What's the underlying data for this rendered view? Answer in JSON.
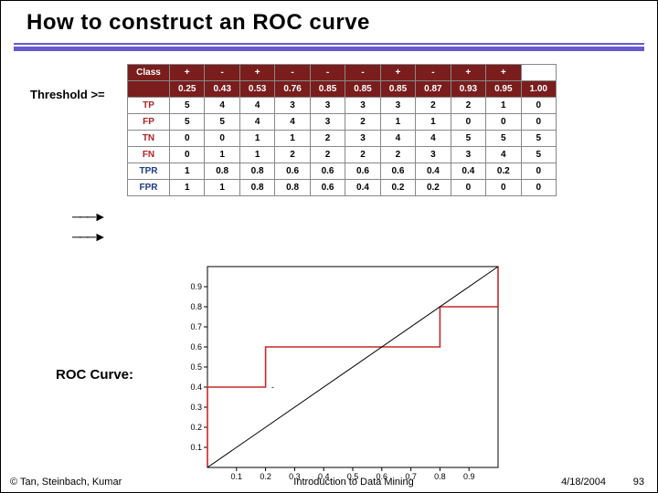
{
  "title": "How to construct an ROC curve",
  "labels": {
    "threshold": "Threshold >=",
    "roc_curve": "ROC Curve:"
  },
  "table": {
    "row_headers": [
      "Class",
      "",
      "TP",
      "FP",
      "TN",
      "FN",
      "TPR",
      "FPR"
    ],
    "class_row": [
      "+",
      "-",
      "+",
      "-",
      "-",
      "-",
      "+",
      "-",
      "+",
      "+",
      ""
    ],
    "threshold_row": [
      "0.25",
      "0.43",
      "0.53",
      "0.76",
      "0.85",
      "0.85",
      "0.85",
      "0.87",
      "0.93",
      "0.95",
      "1.00"
    ],
    "tp": [
      "5",
      "4",
      "4",
      "3",
      "3",
      "3",
      "3",
      "2",
      "2",
      "1",
      "0"
    ],
    "fp": [
      "5",
      "5",
      "4",
      "4",
      "3",
      "2",
      "1",
      "1",
      "0",
      "0",
      "0"
    ],
    "tn": [
      "0",
      "0",
      "1",
      "1",
      "2",
      "3",
      "4",
      "4",
      "5",
      "5",
      "5"
    ],
    "fn": [
      "0",
      "1",
      "1",
      "2",
      "2",
      "2",
      "2",
      "3",
      "3",
      "4",
      "5"
    ],
    "tpr": [
      "1",
      "0.8",
      "0.8",
      "0.6",
      "0.6",
      "0.6",
      "0.6",
      "0.4",
      "0.4",
      "0.2",
      "0"
    ],
    "fpr": [
      "1",
      "1",
      "0.8",
      "0.8",
      "0.6",
      "0.4",
      "0.2",
      "0.2",
      "0",
      "0",
      "0"
    ]
  },
  "chart_data": {
    "type": "line",
    "title": "",
    "xlabel": "",
    "ylabel": "",
    "xlim": [
      0,
      1
    ],
    "ylim": [
      0,
      1
    ],
    "x_ticks": [
      0.1,
      0.2,
      0.3,
      0.4,
      0.5,
      0.6,
      0.7,
      0.8,
      0.9
    ],
    "y_ticks": [
      0.1,
      0.2,
      0.3,
      0.4,
      0.5,
      0.6,
      0.7,
      0.8,
      0.9
    ],
    "series": [
      {
        "name": "ROC",
        "x": [
          0,
          0,
          0,
          0.2,
          0.2,
          0.4,
          0.6,
          0.8,
          0.8,
          1,
          1
        ],
        "y": [
          0,
          0.2,
          0.4,
          0.4,
          0.6,
          0.6,
          0.6,
          0.6,
          0.8,
          0.8,
          1
        ],
        "color": "#c62828"
      },
      {
        "name": "diagonal",
        "x": [
          0,
          1
        ],
        "y": [
          0,
          1
        ],
        "color": "#000"
      }
    ]
  },
  "footer": {
    "copyright": "© Tan, Steinbach, Kumar",
    "center": "Introduction to Data Mining",
    "date": "4/18/2004",
    "page": "93"
  }
}
